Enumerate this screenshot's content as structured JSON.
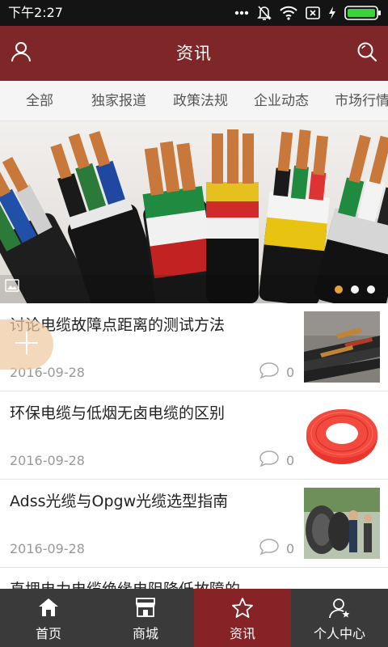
{
  "status_bar": {
    "time": "下午2:27",
    "icons": [
      "more-dots-icon",
      "mute-bell-icon",
      "wifi-icon",
      "sim-x-icon",
      "charging-icon",
      "battery-icon"
    ],
    "battery_color": "#3cd23c"
  },
  "header": {
    "title": "资讯",
    "left_icon": "user-icon",
    "right_icon": "search-icon",
    "background": "#7f2628"
  },
  "tabs": [
    {
      "label": "全部"
    },
    {
      "label": "独家报道"
    },
    {
      "label": "政策法规"
    },
    {
      "label": "企业动态"
    },
    {
      "label": "市场行情"
    }
  ],
  "banner": {
    "image": "power-cables-photo",
    "dots": 3,
    "active_dot": 0
  },
  "news": [
    {
      "title": "讨论电缆故障点距离的测试方法",
      "date": "2016-09-28",
      "comments": "0",
      "thumb": "cable-ends-photo"
    },
    {
      "title": "环保电缆与低烟无卤电缆的区别",
      "date": "2016-09-28",
      "comments": "0",
      "thumb": "red-cable-coil-photo"
    },
    {
      "title": "Adss光缆与Opgw光缆选型指南",
      "date": "2016-09-28",
      "comments": "0",
      "thumb": "cable-drums-photo"
    },
    {
      "title": "直埋电力电缆绝缘电阻降低故障的",
      "date": "",
      "comments": "",
      "thumb": ""
    }
  ],
  "fab": {
    "icon": "plus-icon"
  },
  "bottom_nav": [
    {
      "label": "首页",
      "icon": "home-icon"
    },
    {
      "label": "商城",
      "icon": "store-icon"
    },
    {
      "label": "资讯",
      "icon": "star-icon",
      "active": true
    },
    {
      "label": "个人中心",
      "icon": "user-star-icon"
    }
  ]
}
